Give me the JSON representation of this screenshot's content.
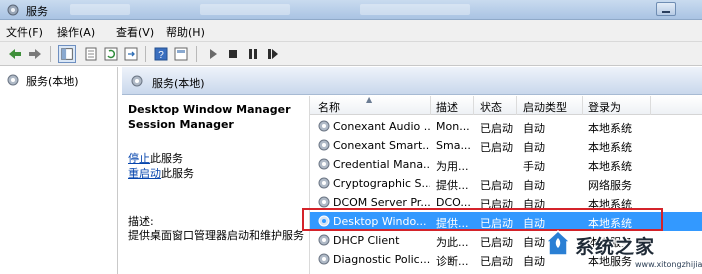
{
  "window": {
    "title": "服务"
  },
  "menu": [
    "文件(F)",
    "操作(A)",
    "查看(V)",
    "帮助(H)"
  ],
  "left_pane": {
    "tree_item": "服务(本地)"
  },
  "right_header": {
    "label": "服务(本地)"
  },
  "detail": {
    "service_name": "Desktop Window Manager Session Manager",
    "stop_link": "停止",
    "stop_rest": "此服务",
    "restart_link": "重启动",
    "restart_rest": "此服务",
    "description_label": "描述:",
    "description_text": "提供桌面窗口管理器启动和维护服务"
  },
  "list": {
    "columns": [
      "名称",
      "描述",
      "状态",
      "启动类型",
      "登录为"
    ],
    "rows": [
      {
        "name": "Conexant Audio ...",
        "desc": "Mon...",
        "status": "已启动",
        "startup": "自动",
        "logon": "本地系统"
      },
      {
        "name": "Conexant Smart...",
        "desc": "Sma...",
        "status": "已启动",
        "startup": "自动",
        "logon": "本地系统"
      },
      {
        "name": "Credential Mana...",
        "desc": "为用...",
        "status": "",
        "startup": "手动",
        "logon": "本地系统"
      },
      {
        "name": "Cryptographic S...",
        "desc": "提供...",
        "status": "已启动",
        "startup": "自动",
        "logon": "网络服务"
      },
      {
        "name": "DCOM Server Pr...",
        "desc": "DCO...",
        "status": "已启动",
        "startup": "自动",
        "logon": "本地系统"
      },
      {
        "name": "Desktop Windo...",
        "desc": "提供...",
        "status": "已启动",
        "startup": "自动",
        "logon": "本地系统"
      },
      {
        "name": "DHCP Client",
        "desc": "为此...",
        "status": "已启动",
        "startup": "自动",
        "logon": "本地服务"
      },
      {
        "name": "Diagnostic Polic...",
        "desc": "诊断...",
        "status": "已启动",
        "startup": "自动",
        "logon": "本地服务"
      }
    ]
  },
  "watermark": {
    "brand": "系统之家",
    "url": "www.xitongzhijia.net"
  },
  "colors": {
    "selected_row": "#3399ff",
    "highlight_border": "#d4232a",
    "link": "#0645ad"
  },
  "icons": [
    "services-app-icon",
    "back-arrow-icon",
    "forward-arrow-icon",
    "console-tree-icon",
    "properties-icon",
    "refresh-icon",
    "export-icon",
    "help-icon",
    "details-view-icon",
    "start-icon",
    "stop-icon",
    "pause-icon",
    "restart-icon",
    "gear-icon",
    "minimize-icon"
  ]
}
